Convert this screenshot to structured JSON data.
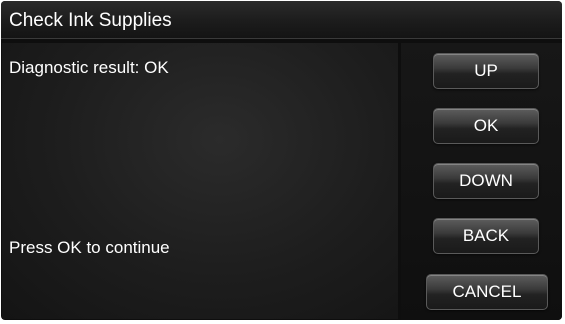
{
  "header": {
    "title": "Check Ink Supplies"
  },
  "content": {
    "result_text": "Diagnostic result: OK",
    "prompt_text": "Press OK to continue"
  },
  "buttons": {
    "up": "UP",
    "ok": "OK",
    "down": "DOWN",
    "back": "BACK",
    "cancel": "CANCEL"
  },
  "colors": {
    "background": "#0e0e0e",
    "text": "#ffffff",
    "button_border": "#5a5a5a"
  }
}
